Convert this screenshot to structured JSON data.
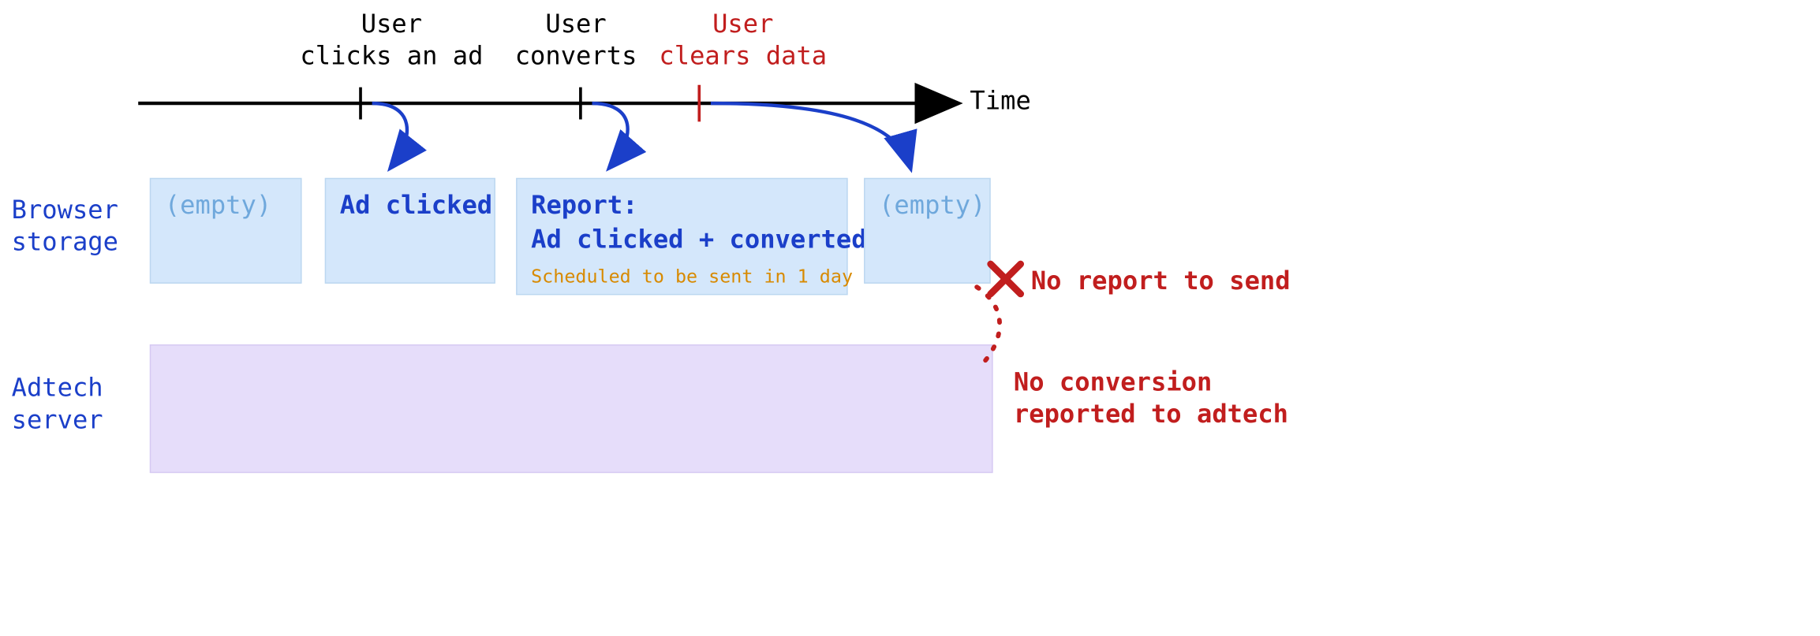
{
  "timeline": {
    "axis_label": "Time",
    "events": [
      {
        "id": "click",
        "label": "User\nclicks an ad",
        "color": "black"
      },
      {
        "id": "convert",
        "label": "User\nconverts",
        "color": "black"
      },
      {
        "id": "clear",
        "label": "User\nclears data",
        "color": "red"
      }
    ]
  },
  "rows": {
    "browser_storage": {
      "label": "Browser\nstorage",
      "states": [
        {
          "id": "s0",
          "text": "(empty)",
          "style": "greyblue"
        },
        {
          "id": "s1",
          "text": "Ad clicked",
          "style": "blue"
        },
        {
          "id": "s2",
          "title": "Report:",
          "body": "Ad clicked + converted",
          "note": "Scheduled to be sent in 1 day",
          "style": "blue"
        },
        {
          "id": "s3",
          "text": "(empty)",
          "style": "greyblue"
        }
      ]
    },
    "adtech_server": {
      "label": "Adtech\nserver"
    }
  },
  "annotations": {
    "no_report": "No report to send",
    "no_conversion": "No conversion\nreported to adtech"
  }
}
